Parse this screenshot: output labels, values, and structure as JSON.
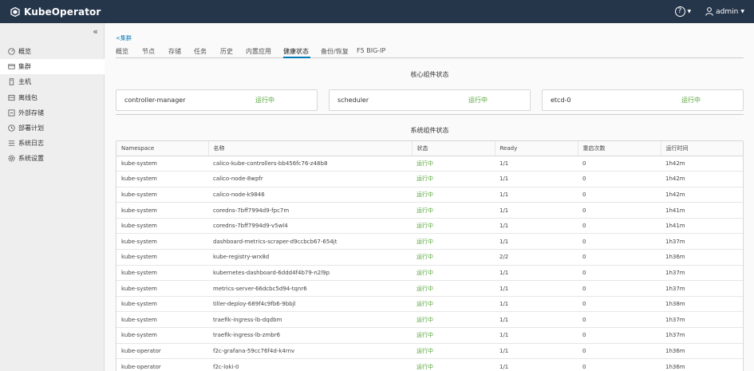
{
  "header": {
    "brand": "KubeOperator",
    "help_icon": "help-icon",
    "user": "admin"
  },
  "sidebar": {
    "collapse_icon": "double-chevron-left-icon",
    "items": [
      {
        "label": "概览",
        "icon": "dashboard-icon",
        "active": false
      },
      {
        "label": "集群",
        "icon": "cluster-icon",
        "active": true
      },
      {
        "label": "主机",
        "icon": "host-icon",
        "active": false
      },
      {
        "label": "离线包",
        "icon": "package-icon",
        "active": false
      },
      {
        "label": "外部存储",
        "icon": "storage-icon",
        "active": false
      },
      {
        "label": "部署计划",
        "icon": "plan-icon",
        "active": false
      },
      {
        "label": "系统日志",
        "icon": "log-icon",
        "active": false
      },
      {
        "label": "系统设置",
        "icon": "settings-icon",
        "active": false
      }
    ]
  },
  "breadcrumb": "<集群",
  "tabs": [
    {
      "label": "概览",
      "active": false
    },
    {
      "label": "节点",
      "active": false
    },
    {
      "label": "存储",
      "active": false
    },
    {
      "label": "任务",
      "active": false
    },
    {
      "label": "历史",
      "active": false
    },
    {
      "label": "内置应用",
      "active": false
    },
    {
      "label": "健康状态",
      "active": true
    },
    {
      "label": "备份/恢复",
      "active": false
    },
    {
      "label": "F5 BIG-IP",
      "active": false
    }
  ],
  "core": {
    "title": "核心组件状态",
    "components": [
      {
        "name": "controller-manager",
        "status": "运行中"
      },
      {
        "name": "scheduler",
        "status": "运行中"
      },
      {
        "name": "etcd-0",
        "status": "运行中"
      }
    ]
  },
  "system": {
    "title": "系统组件状态",
    "columns": [
      "Namespace",
      "名称",
      "状态",
      "Ready",
      "重启次数",
      "运行时间"
    ],
    "rows": [
      [
        "kube-system",
        "calico-kube-controllers-bb456fc76-z48b8",
        "运行中",
        "1/1",
        "0",
        "1h42m"
      ],
      [
        "kube-system",
        "calico-node-8wpfr",
        "运行中",
        "1/1",
        "0",
        "1h42m"
      ],
      [
        "kube-system",
        "calico-node-k9846",
        "运行中",
        "1/1",
        "0",
        "1h42m"
      ],
      [
        "kube-system",
        "coredns-7bff7994d9-fpc7m",
        "运行中",
        "1/1",
        "0",
        "1h41m"
      ],
      [
        "kube-system",
        "coredns-7bff7994d9-v5wl4",
        "运行中",
        "1/1",
        "0",
        "1h41m"
      ],
      [
        "kube-system",
        "dashboard-metrics-scraper-d9ccbcb67-654jt",
        "运行中",
        "1/1",
        "0",
        "1h37m"
      ],
      [
        "kube-system",
        "kube-registry-wrx8d",
        "运行中",
        "2/2",
        "0",
        "1h36m"
      ],
      [
        "kube-system",
        "kubernetes-dashboard-6ddd4f4b79-n2l9p",
        "运行中",
        "1/1",
        "0",
        "1h37m"
      ],
      [
        "kube-system",
        "metrics-server-66dcbc5d94-tqnr6",
        "运行中",
        "1/1",
        "0",
        "1h37m"
      ],
      [
        "kube-system",
        "tiller-deploy-689f4c9fb6-9bbjl",
        "运行中",
        "1/1",
        "0",
        "1h38m"
      ],
      [
        "kube-system",
        "traefik-ingress-lb-dqdbm",
        "运行中",
        "1/1",
        "0",
        "1h37m"
      ],
      [
        "kube-system",
        "traefik-ingress-lb-zmbr6",
        "运行中",
        "1/1",
        "0",
        "1h37m"
      ],
      [
        "kube-operator",
        "f2c-grafana-59cc76f4d-k4rnv",
        "运行中",
        "1/1",
        "0",
        "1h36m"
      ],
      [
        "kube-operator",
        "f2c-loki-0",
        "运行中",
        "1/1",
        "0",
        "1h36m"
      ]
    ]
  }
}
